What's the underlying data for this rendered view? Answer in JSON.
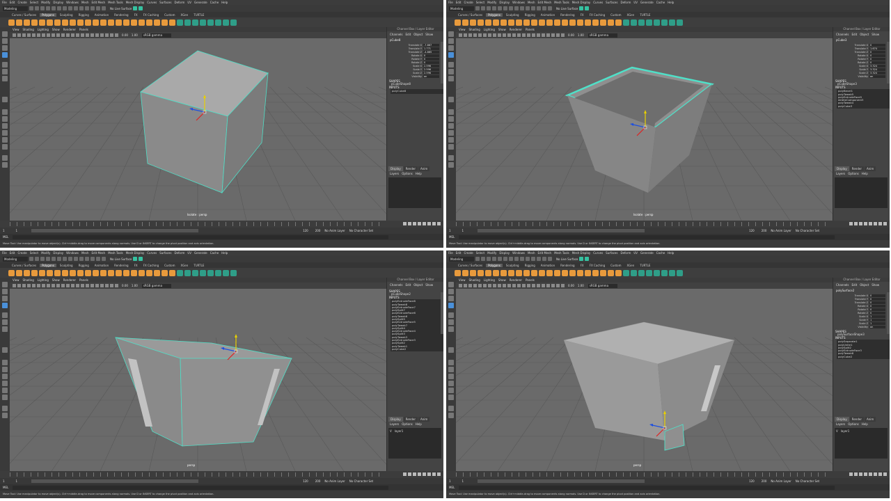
{
  "menus": [
    "File",
    "Edit",
    "Create",
    "Select",
    "Modify",
    "Display",
    "Windows",
    "Mesh",
    "Edit Mesh",
    "Mesh Tools",
    "Mesh Display",
    "Curves",
    "Surfaces",
    "Deform",
    "UV",
    "Generate",
    "Cache",
    "Help"
  ],
  "workspace_mode": "Modeling",
  "live_surface": "No Live Surface",
  "shelf_tabs": [
    "Curves / Surfaces",
    "Polygons",
    "Sculpting",
    "Rigging",
    "Animation",
    "Rendering",
    "FX",
    "FX Caching",
    "Custom",
    "XGen",
    "TURTLE"
  ],
  "active_shelf": "Polygons",
  "viewport_menu": [
    "View",
    "Shading",
    "Lighting",
    "Show",
    "Renderer",
    "Panels"
  ],
  "viewport_values": {
    "a": "0.00",
    "b": "1.00",
    "color_space": "sRGB gamma"
  },
  "channel_box_title": "Channel Box / Layer Editor",
  "channel_menu": [
    "Channels",
    "Edit",
    "Object",
    "Show"
  ],
  "layer_tabs": [
    "Display",
    "Render",
    "Anim"
  ],
  "layer_menu": [
    "Layers",
    "Options",
    "Help"
  ],
  "shapes_label": "SHAPES",
  "inputs_label": "INPUTS",
  "range": {
    "start": "1",
    "current": "1",
    "end": "120",
    "max": "200",
    "anim_layer": "No Anim Layer",
    "char_set": "No Character Set"
  },
  "mel_label": "MEL",
  "help_text": "Move Tool: Use manipulator to move object(s). Ctrl+middle-drag to move components along normals. Use D or INSERT to change the pivot position and axis orientation.",
  "panels": [
    {
      "object": "pCube8",
      "camera": "Isolate : persp",
      "attrs": [
        [
          "Translate X",
          "-7.867"
        ],
        [
          "Translate Y",
          "1.771"
        ],
        [
          "Translate Z",
          "-4.865"
        ],
        [
          "Rotate X",
          "0"
        ],
        [
          "Rotate Y",
          "0"
        ],
        [
          "Rotate Z",
          "0"
        ],
        [
          "Scale X",
          "2.596"
        ],
        [
          "Scale Y",
          "2.596"
        ],
        [
          "Scale Z",
          "2.596"
        ],
        [
          "Visibility",
          "on"
        ]
      ],
      "shapes": "pCubeShape8",
      "inputs": [
        "polyCube8"
      ],
      "layers": []
    },
    {
      "object": "pCube3",
      "camera": "Isolate : persp",
      "attrs": [
        [
          "Translate X",
          "0"
        ],
        [
          "Translate Y",
          "1.674"
        ],
        [
          "Translate Z",
          "0"
        ],
        [
          "Rotate X",
          "0"
        ],
        [
          "Rotate Y",
          "0"
        ],
        [
          "Rotate Z",
          "0"
        ],
        [
          "Scale X",
          "3.324"
        ],
        [
          "Scale Y",
          "3.324"
        ],
        [
          "Scale Z",
          "3.324"
        ],
        [
          "Visibility",
          "on"
        ]
      ],
      "shapes": "pCubeShape3",
      "inputs": [
        "polyBevel1",
        "polyTweak5",
        "polyExtrudeFace9",
        "deleteComponent3",
        "polyTweak4",
        "polyCube3"
      ],
      "layers": []
    },
    {
      "object": "",
      "camera": "persp",
      "attrs": [],
      "shapes": "pCubeShape2",
      "inputs": [
        "polyExtrudeFace8",
        "polyTweak8",
        "polyExtrudeFace7",
        "polySplit7",
        "polyExtrudeFace6",
        "polyTweak6",
        "polySplit5",
        "polyExtrudeFace5",
        "polyTweak7",
        "polySplit4",
        "polyExtrudeFace4",
        "polySplit3",
        "polyTweak3",
        "polyExtrudeFace3",
        "polySplit2",
        "polyTweak1",
        "polyCube2"
      ],
      "layers": [
        "layer1"
      ]
    },
    {
      "object": "polySurface2",
      "camera": "persp",
      "attrs": [
        [
          "Translate X",
          "0"
        ],
        [
          "Translate Y",
          "0"
        ],
        [
          "Translate Z",
          "0"
        ],
        [
          "Rotate X",
          "0"
        ],
        [
          "Rotate Y",
          "0"
        ],
        [
          "Rotate Z",
          "0"
        ],
        [
          "Scale X",
          "1"
        ],
        [
          "Scale Y",
          "1"
        ],
        [
          "Scale Z",
          "1"
        ],
        [
          "Visibility",
          "on"
        ]
      ],
      "shapes": "polySurfaceShape3",
      "inputs": [
        "polySeparate1",
        "polyUnite1",
        "polySplit2",
        "polyExtrudeFace3",
        "polyTweak8",
        "polyCube2"
      ],
      "layers": [
        "layer1"
      ]
    }
  ],
  "colors": {
    "accent": "#35c1a0",
    "orange_icon": "#e89a3c",
    "viewport_bg": "#6a6a6a",
    "selection": "#4fe0c8"
  }
}
